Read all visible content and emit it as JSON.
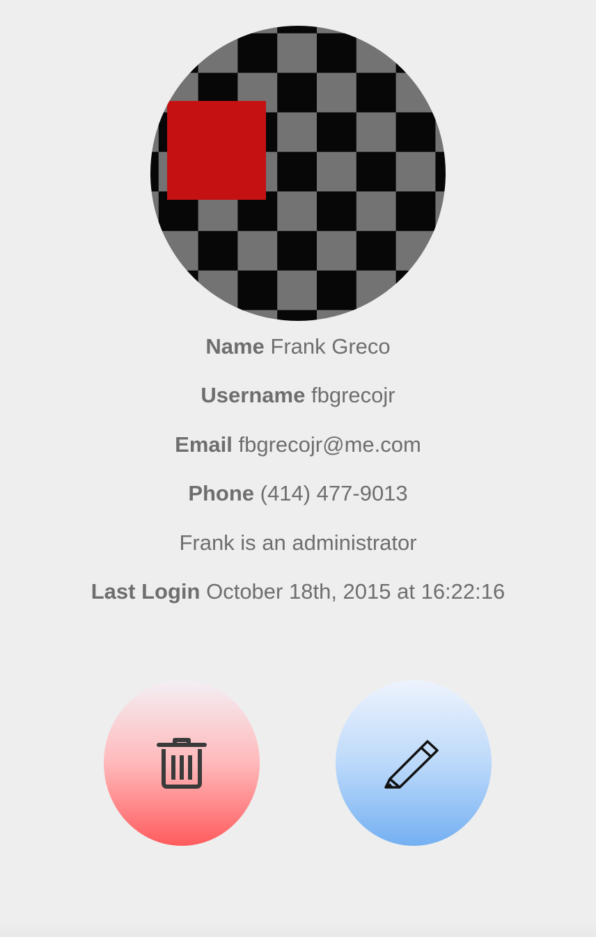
{
  "profile": {
    "avatar": {
      "icon": "checkerboard-avatar",
      "colors": {
        "dark": "#070707",
        "light": "#737373",
        "accent": "#c51112"
      }
    },
    "name": {
      "label": "Name",
      "value": "Frank Greco"
    },
    "username": {
      "label": "Username",
      "value": "fbgrecojr"
    },
    "email": {
      "label": "Email",
      "value": "fbgrecojr@me.com"
    },
    "phone": {
      "label": "Phone",
      "value": "(414) 477-9013"
    },
    "role_text": "Frank is an administrator",
    "last_login": {
      "label": "Last Login",
      "value": "October 18th, 2015 at 16:22:16"
    }
  },
  "actions": {
    "delete": {
      "icon": "trash-icon",
      "color": "#ff5b5d"
    },
    "edit": {
      "icon": "pencil-icon",
      "color": "#74b0f2"
    }
  }
}
